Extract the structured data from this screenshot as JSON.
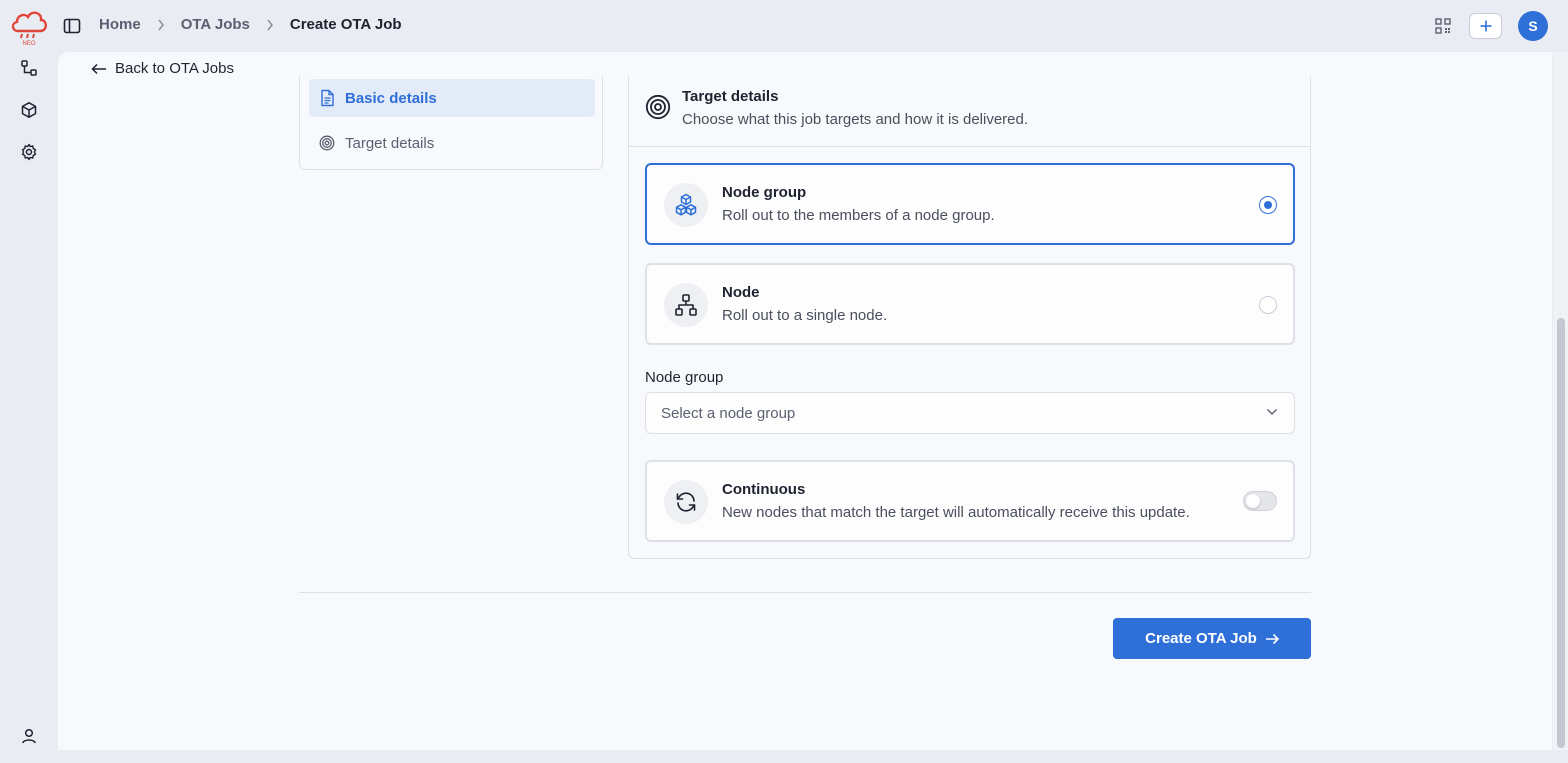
{
  "topbar": {
    "logo_text": "NEO",
    "breadcrumb": [
      {
        "label": "Home"
      },
      {
        "label": "OTA Jobs"
      },
      {
        "label": "Create OTA Job"
      }
    ],
    "avatar_initial": "S"
  },
  "nav": {
    "back_label": "Back to OTA Jobs"
  },
  "steps": [
    {
      "label": "Basic details",
      "icon": "document-icon",
      "active": true
    },
    {
      "label": "Target details",
      "icon": "target-icon",
      "active": false
    }
  ],
  "target": {
    "title": "Target details",
    "subtitle": "Choose what this job targets and how it is delivered.",
    "options": [
      {
        "title": "Node group",
        "description": "Roll out to the members of a node group.",
        "icon": "boxes-icon",
        "selected": true
      },
      {
        "title": "Node",
        "description": "Roll out to a single node.",
        "icon": "hierarchy-icon",
        "selected": false
      }
    ],
    "node_group_field": {
      "label": "Node group",
      "placeholder": "Select a node group"
    },
    "continuous": {
      "title": "Continuous",
      "description": "New nodes that match the target will automatically receive this update.",
      "enabled": false
    }
  },
  "actions": {
    "create_label": "Create OTA Job"
  },
  "colors": {
    "accent": "#2f6fd8",
    "logo": "#e0473b"
  }
}
